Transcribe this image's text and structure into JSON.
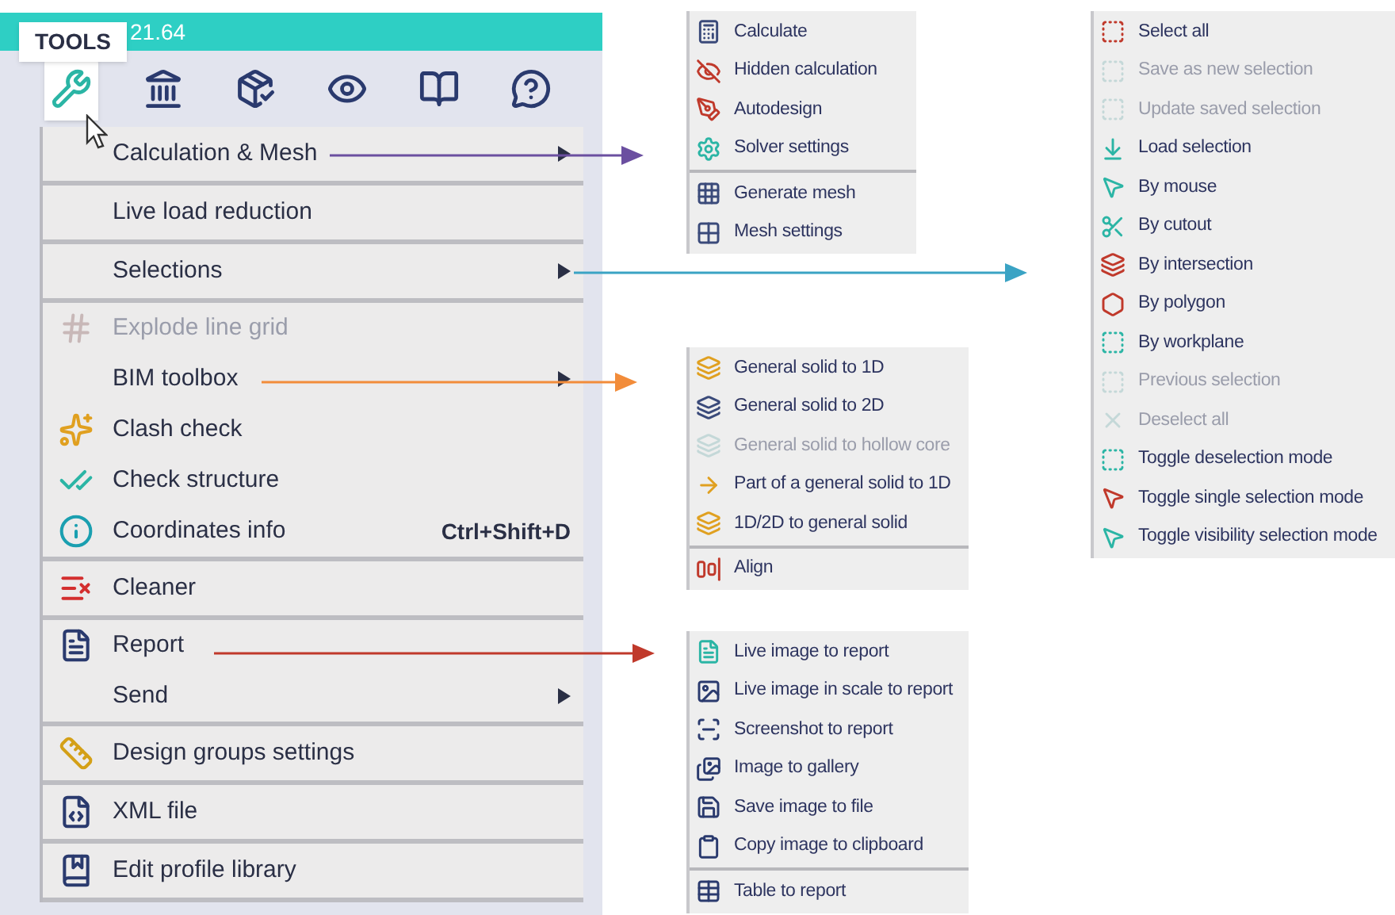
{
  "title_bar": {
    "tooltip": "TOOLS",
    "text": "21.64"
  },
  "toolbar": [
    {
      "kind": "tools",
      "selected": true
    },
    {
      "kind": "structure",
      "selected": false
    },
    {
      "kind": "check",
      "selected": false
    },
    {
      "kind": "view",
      "selected": false
    },
    {
      "kind": "library",
      "selected": false
    },
    {
      "kind": "help",
      "selected": false
    }
  ],
  "menu": {
    "groups": [
      {
        "items": [
          {
            "label": "Calculation & Mesh",
            "submenu": true,
            "disabled": false
          }
        ]
      },
      {
        "items": [
          {
            "label": "Live load reduction",
            "submenu": false,
            "disabled": false
          }
        ]
      },
      {
        "items": [
          {
            "label": "Selections",
            "submenu": true,
            "disabled": false
          }
        ]
      },
      {
        "items": [
          {
            "label": "Explode line grid",
            "submenu": false,
            "disabled": true
          },
          {
            "label": "BIM toolbox",
            "submenu": true,
            "disabled": false
          },
          {
            "label": "Clash check",
            "submenu": false,
            "disabled": false
          },
          {
            "label": "Check structure",
            "submenu": false,
            "disabled": false
          },
          {
            "label": "Coordinates info",
            "shortcut": "Ctrl+Shift+D",
            "submenu": false,
            "disabled": false
          }
        ]
      },
      {
        "items": [
          {
            "label": "Cleaner",
            "submenu": false,
            "disabled": false
          }
        ]
      },
      {
        "items": [
          {
            "label": "Report",
            "submenu": false,
            "disabled": false
          },
          {
            "label": "Send",
            "submenu": true,
            "disabled": false
          }
        ]
      },
      {
        "items": [
          {
            "label": "Design groups settings",
            "submenu": false,
            "disabled": false
          }
        ]
      },
      {
        "items": [
          {
            "label": "XML file",
            "submenu": false,
            "disabled": false
          }
        ]
      },
      {
        "items": [
          {
            "label": "Edit profile library",
            "submenu": false,
            "disabled": false
          }
        ]
      }
    ]
  },
  "submenus": [
    {
      "color": "#6b4fa0",
      "groups": [
        [
          {
            "label": "Calculate",
            "disabled": false
          },
          {
            "label": "Hidden calculation",
            "disabled": false
          },
          {
            "label": "Autodesign",
            "disabled": false
          },
          {
            "label": "Solver settings",
            "disabled": false
          }
        ],
        [
          {
            "label": "Generate mesh",
            "disabled": false
          },
          {
            "label": "Mesh settings",
            "disabled": false
          }
        ]
      ]
    },
    {
      "color": "#3aa3c4",
      "groups": [
        [
          {
            "label": "Select all",
            "disabled": false
          },
          {
            "label": "Save as new selection",
            "disabled": true
          },
          {
            "label": "Update saved selection",
            "disabled": true
          },
          {
            "label": "Load selection",
            "disabled": false
          },
          {
            "label": "By mouse",
            "disabled": false
          },
          {
            "label": "By cutout",
            "disabled": false
          },
          {
            "label": "By intersection",
            "disabled": false
          },
          {
            "label": "By polygon",
            "disabled": false
          },
          {
            "label": "By workplane",
            "disabled": false
          },
          {
            "label": "Previous selection",
            "disabled": true
          },
          {
            "label": "Deselect all",
            "disabled": true
          },
          {
            "label": "Toggle deselection mode",
            "disabled": false
          },
          {
            "label": "Toggle single selection mode",
            "disabled": false
          },
          {
            "label": "Toggle visibility selection mode",
            "disabled": false
          }
        ]
      ]
    },
    {
      "color": "#f28c3a",
      "groups": [
        [
          {
            "label": "General solid to 1D",
            "disabled": false
          },
          {
            "label": "General solid to 2D",
            "disabled": false
          },
          {
            "label": "General solid to hollow core",
            "disabled": true
          },
          {
            "label": "Part of a general solid to 1D",
            "disabled": false
          },
          {
            "label": "1D/2D to general solid",
            "disabled": false
          }
        ],
        [
          {
            "label": "Align",
            "disabled": false
          }
        ]
      ]
    },
    {
      "color": "#c0392b",
      "groups": [
        [
          {
            "label": "Live image to report",
            "disabled": false
          },
          {
            "label": "Live image in scale to report",
            "disabled": false
          },
          {
            "label": "Screenshot to report",
            "disabled": false
          },
          {
            "label": "Image to gallery",
            "disabled": false
          },
          {
            "label": "Save image to file",
            "disabled": false
          },
          {
            "label": "Copy image to clipboard",
            "disabled": false
          }
        ],
        [
          {
            "label": "Table to report",
            "disabled": false
          }
        ]
      ]
    }
  ]
}
